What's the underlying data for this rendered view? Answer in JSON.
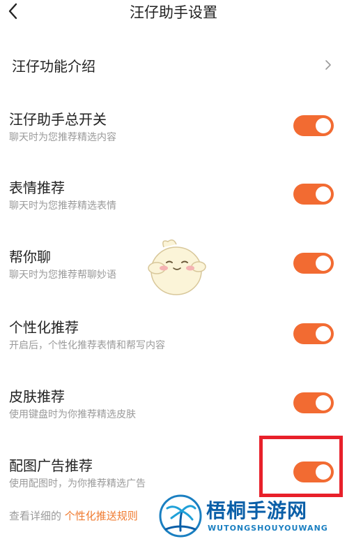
{
  "header": {
    "title": "汪仔助手设置"
  },
  "intro": {
    "label": "汪仔功能介绍"
  },
  "settings": [
    {
      "title": "汪仔助手总开关",
      "subtitle": "聊天时为您推荐精选内容",
      "enabled": true
    },
    {
      "title": "表情推荐",
      "subtitle": "聊天时为您推荐精选表情",
      "enabled": true
    },
    {
      "title": "帮你聊",
      "subtitle": "聊天时为您推荐帮聊妙语",
      "enabled": true
    },
    {
      "title": "个性化推荐",
      "subtitle": "开启后，个性化推荐表情和帮写内容",
      "enabled": true
    },
    {
      "title": "皮肤推荐",
      "subtitle": "使用键盘时为你推荐精选皮肤",
      "enabled": true
    },
    {
      "title": "配图广告推荐",
      "subtitle": "使用配图时，为你推荐精选广告",
      "enabled": true
    }
  ],
  "footer": {
    "prefix": "查看详细的",
    "link": "个性化推送规则"
  },
  "watermark": {
    "name": "梧桐手游网",
    "sub": "WUTONGSHOUYOUWANG"
  },
  "colors": {
    "accent": "#f26b32",
    "highlight": "#e8202a"
  },
  "icons": {
    "back": "chevron-left-icon",
    "intro": "chevron-right-icon"
  }
}
